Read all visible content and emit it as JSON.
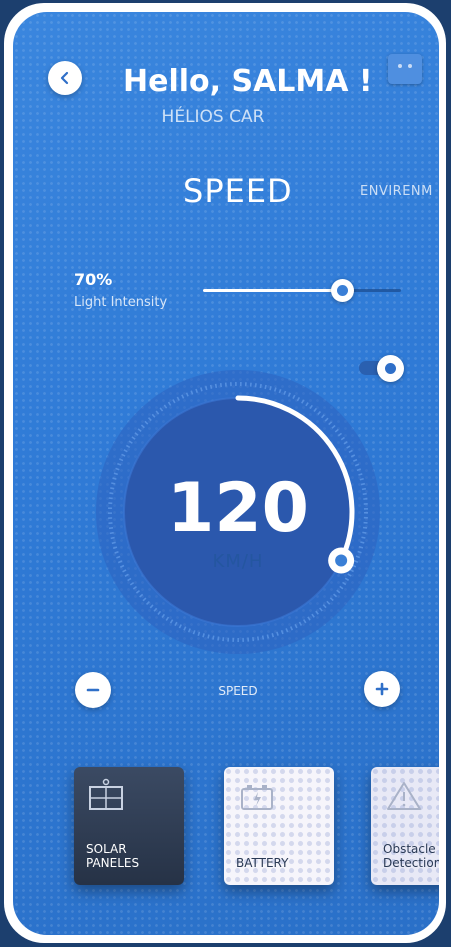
{
  "header": {
    "greeting": "Hello, SALMA !",
    "car_name": "HÉLIOS CAR"
  },
  "tabs": [
    {
      "label": "SPEED",
      "active": true
    },
    {
      "label": "ENVIRENM",
      "active": false
    }
  ],
  "light_intensity": {
    "value_text": "70%",
    "label": "Light Intensity",
    "value": 70
  },
  "toggle": {
    "on": true
  },
  "speedometer": {
    "value": "120",
    "unit": "KM/H",
    "progress": 0.32
  },
  "controls": {
    "caption": "SPEED"
  },
  "cards": [
    {
      "label_line1": "SOLAR",
      "label_line2": "PANELES",
      "icon": "solar-panel-icon"
    },
    {
      "label_line1": "BATTERY",
      "label_line2": "",
      "icon": "battery-icon"
    },
    {
      "label_line1": "Obstacle",
      "label_line2": "Detection",
      "icon": "warning-icon"
    }
  ],
  "colors": {
    "background": "#2f7ad6",
    "accent": "#ffffff",
    "card_dark": "#2c3850",
    "card_light": "#f6f5fb"
  }
}
